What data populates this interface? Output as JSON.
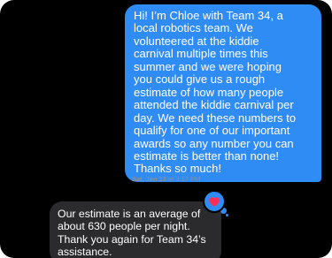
{
  "conversation": {
    "outgoing_message": "Hi! I’m Chloe with Team 34, a\nlocal robotics team. We\nvolunteered at the kiddie\ncarnival multiple times this\nsummer and we were hoping\nyou could give us a rough\nestimate of how many people\nattended the kiddie carnival per\nday. We need these numbers to\nqualify for one of our important\nawards so any number you can\nestimate is better than none!\nThanks so much!",
    "timestamp_date": "Sat, Jan 13",
    "timestamp_time": " at 3:17 PM",
    "reaction_icon": "heart-icon",
    "incoming_message": "Our estimate is an average of\nabout 630 people per night.\nThank you again for Team 34’s\nassistance."
  },
  "colors": {
    "background": "#000000",
    "outgoing_bubble": "#2f8cf4",
    "incoming_bubble": "#2b2b2d",
    "reaction_heart": "#ff2d55",
    "timestamp_text": "#8e8e93"
  }
}
